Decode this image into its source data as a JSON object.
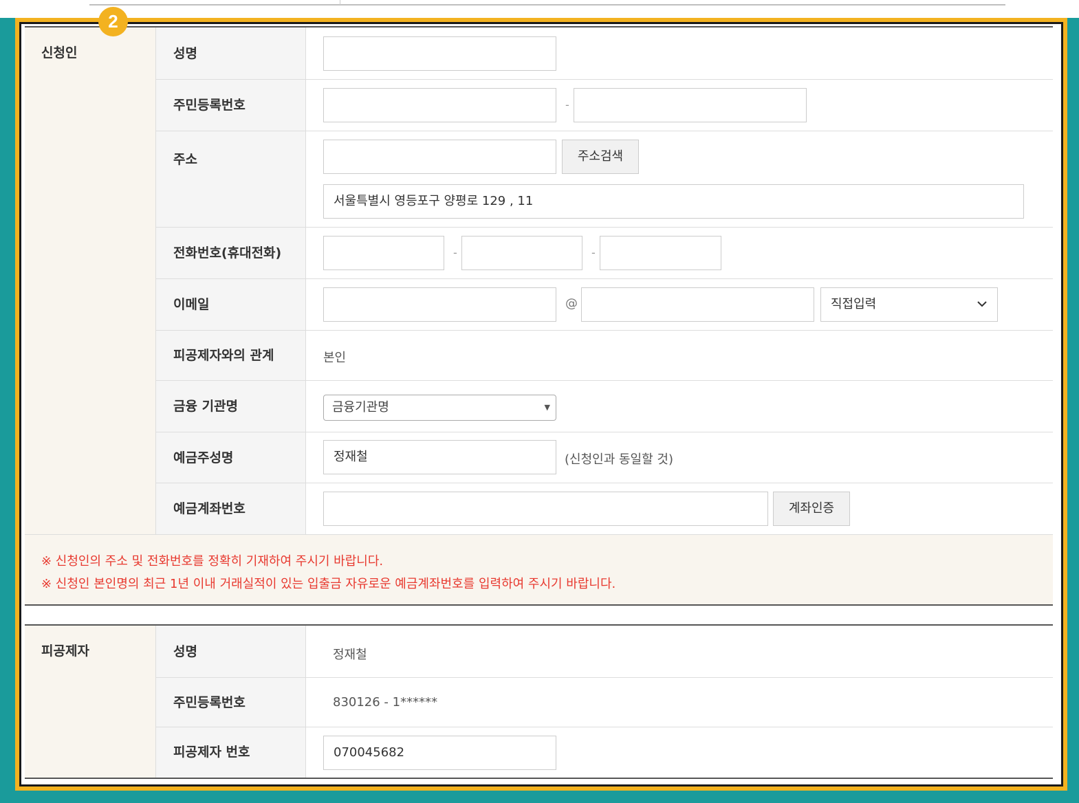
{
  "step_badge": "2",
  "applicant": {
    "section_label": "신청인",
    "name_label": "성명",
    "rrn_label": "주민등록번호",
    "rrn_dash": "-",
    "address_label": "주소",
    "address_search_button": "주소검색",
    "address_detail_value": "서울특별시 영등포구 양평로 129 , 11",
    "phone_label": "전화번호(휴대전화)",
    "phone_dash": "-",
    "email_label": "이메일",
    "email_at": "@",
    "email_domain_select": "직접입력",
    "relation_label": "피공제자와의 관계",
    "relation_value": "본인",
    "bank_label": "금융 기관명",
    "bank_select": "금융기관명",
    "holder_label": "예금주성명",
    "holder_value": "정재철",
    "holder_note": "(신청인과 동일할 것)",
    "account_label": "예금계좌번호",
    "account_verify_button": "계좌인증",
    "notices": [
      "※ 신청인의 주소 및 전화번호를 정확히 기재하여 주시기 바랍니다.",
      "※ 신청인 본인명의 최근 1년 이내 거래실적이 있는 입출금 자유로운 예금계좌번호를 입력하여 주시기 바랍니다."
    ]
  },
  "insured": {
    "section_label": "피공제자",
    "name_label": "성명",
    "name_value": "정재철",
    "rrn_label": "주민등록번호",
    "rrn_value": "830126 - 1******",
    "number_label": "피공제자 번호",
    "number_value": "070045682"
  },
  "colors": {
    "frame_border": "#f3b220",
    "background": "#1a9b9b",
    "notice_text": "#e8392f",
    "category_bg": "#f9f5ee"
  },
  "icons": {
    "select_arrow": "chevron-down-icon",
    "dropdown_arrow": "triangle-down-icon"
  }
}
